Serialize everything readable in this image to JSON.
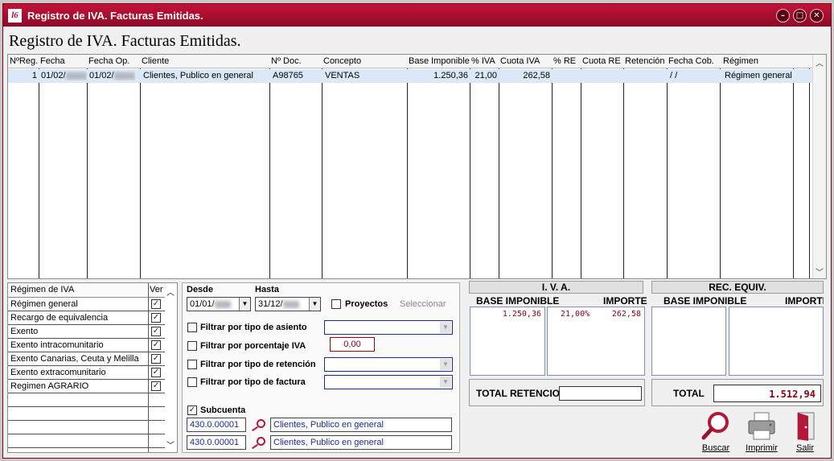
{
  "window": {
    "title": "Registro de IVA. Facturas Emitidas.",
    "logo": "l6",
    "min_glyph": "–",
    "max_glyph": "□",
    "close_glyph": "✕"
  },
  "heading": "Registro de IVA. Facturas Emitidas.",
  "grid": {
    "columns": [
      "NºReg.",
      "Fecha",
      "Fecha Op.",
      "Cliente",
      "Nº Doc.",
      "Concepto",
      "Base Imponible",
      "% IVA",
      "Cuota IVA",
      "% RE",
      "Cuota RE",
      "Retención",
      "Fecha Cob.",
      "Régimen"
    ],
    "rows": [
      {
        "nreg": "1",
        "fecha": "01/02/",
        "fecha_op": "01/02/",
        "cliente": "Clientes, Publico en general",
        "ndoc": "A98765",
        "concepto": "VENTAS",
        "base": "1.250,36",
        "pct_iva": "21,00",
        "cuota_iva": "262,58",
        "pct_re": "",
        "cuota_re": "",
        "retencion": "",
        "fecha_cob": "/  /",
        "regimen": "Régimen general"
      }
    ]
  },
  "regimen_list": {
    "header": "Régimen de IVA",
    "ver_header": "Ver",
    "items": [
      "Régimen general",
      "Recargo de equivalencia",
      "Exento",
      "Exento intracomunitario",
      "Exento Canarias, Ceuta y Melilla",
      "Exento extracomunitario",
      "Regimen AGRARIO"
    ],
    "check_glyph": "✓"
  },
  "filters": {
    "desde_label": "Desde",
    "hasta_label": "Hasta",
    "desde_value": "01/01/",
    "hasta_value": "31/12/",
    "proyectos_label": "Proyectos",
    "seleccionar_label": "Seleccionar",
    "tipo_asiento_label": "Filtrar por tipo de asiento",
    "porcentaje_iva_label": "Filtrar por porcentaje IVA",
    "porcentaje_iva_value": "0,00",
    "tipo_retencion_label": "Filtrar por tipo de retención",
    "tipo_factura_label": "Filtrar por tipo de factura",
    "subcuenta_label": "Subcuenta",
    "subcuenta_1_code": "430.0.00001",
    "subcuenta_1_name": "Clientes, Publico en general",
    "subcuenta_2_code": "430.0.00001",
    "subcuenta_2_name": "Clientes, Publico en general",
    "dropdown_glyph": "▼",
    "check_glyph": "✓"
  },
  "iva": {
    "title": "I. V. A.",
    "base_header": "BASE IMPONIBLE",
    "importe_header": "IMPORTE",
    "base_value": "1.250,36",
    "pct_value": "21,00%",
    "importe_value": "262,58",
    "total_retencion_label": "TOTAL RETENCIO"
  },
  "rec_equiv": {
    "title": "REC. EQUIV.",
    "base_header": "BASE IMPONIBLE",
    "importe_header": "IMPORTE",
    "total_label": "TOTAL",
    "total_value": "1.512,94"
  },
  "actions": {
    "buscar": "Buscar",
    "imprimir": "Imprimir",
    "salir": "Salir"
  },
  "colors": {
    "title_bar": "#b0102f",
    "accent_red": "#8a0015",
    "selected_row": "#dbe8f8",
    "link_blue": "#1c2a9c"
  }
}
